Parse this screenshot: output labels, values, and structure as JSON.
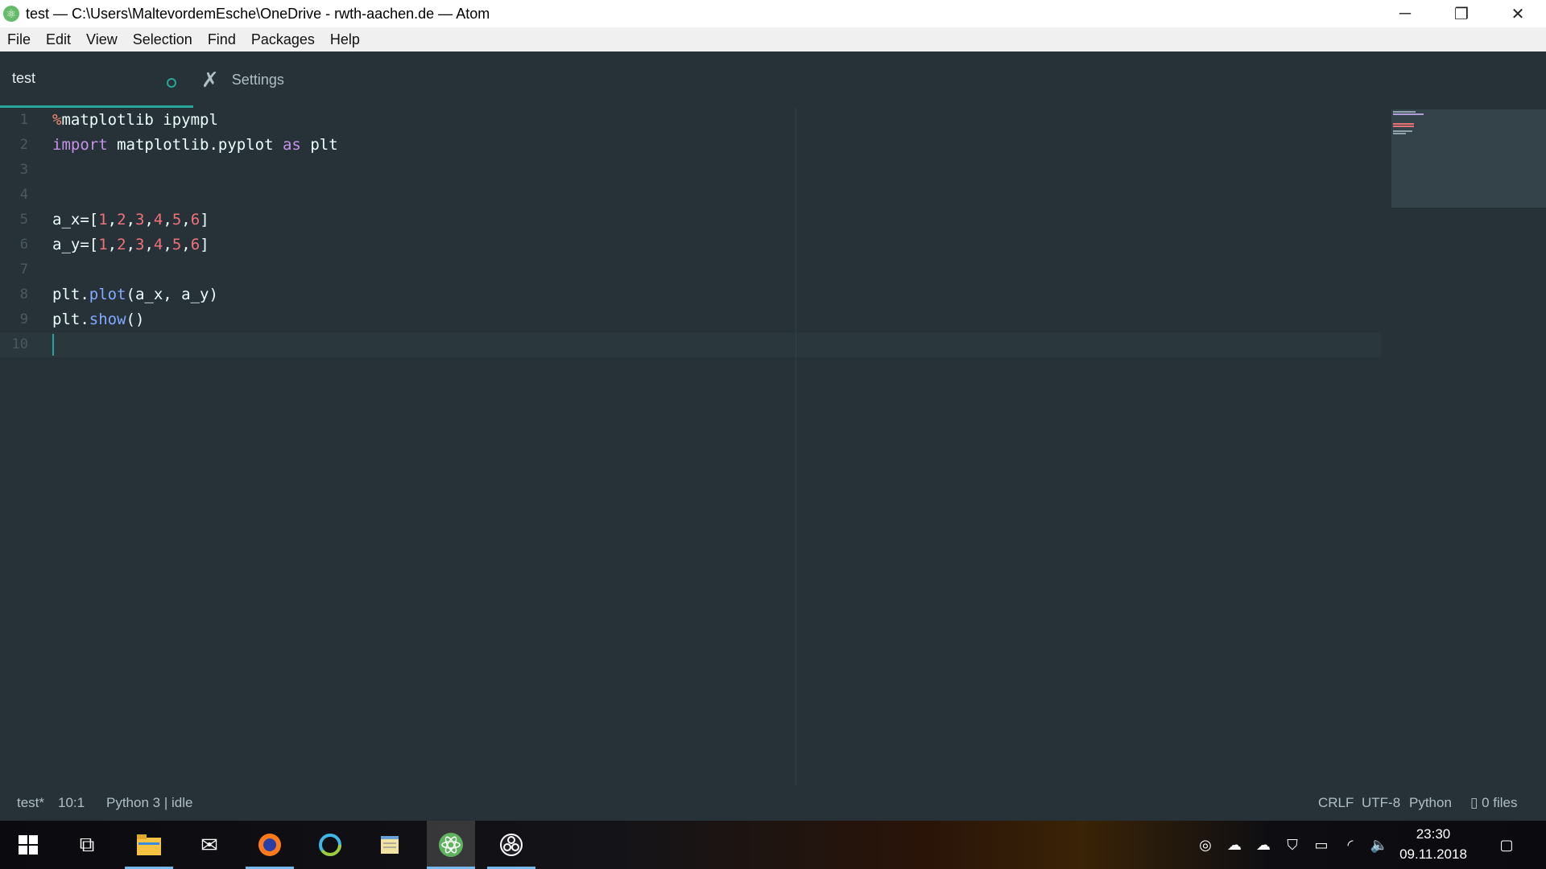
{
  "window": {
    "title": "test — C:\\Users\\MaltevordemEsche\\OneDrive - rwth-aachen.de — Atom",
    "controls": {
      "minimize": "─",
      "restore": "❐",
      "close": "✕"
    }
  },
  "menu": [
    "File",
    "Edit",
    "View",
    "Selection",
    "Find",
    "Packages",
    "Help"
  ],
  "tabs": [
    {
      "title": "test",
      "modified": true
    },
    {
      "title": "Settings"
    }
  ],
  "editor": {
    "line_numbers": [
      "1",
      "2",
      "3",
      "4",
      "5",
      "6",
      "7",
      "8",
      "9",
      "10"
    ],
    "lines": {
      "l1": {
        "magic": "%",
        "rest": "matplotlib ipympl"
      },
      "l2": {
        "kw_import": "import",
        "module": " matplotlib.pyplot ",
        "kw_as": "as",
        "alias": " plt"
      },
      "l5": {
        "name": "a_x=[",
        "n1": "1",
        "n2": "2",
        "n3": "3",
        "n4": "4",
        "n5": "5",
        "n6": "6",
        "close": "]"
      },
      "l6": {
        "name": "a_y=[",
        "n1": "1",
        "n2": "2",
        "n3": "3",
        "n4": "4",
        "n5": "5",
        "n6": "6",
        "close": "]"
      },
      "l8": {
        "obj": "plt.",
        "fn": "plot",
        "args": "(a_x, a_y)"
      },
      "l9": {
        "obj": "plt.",
        "fn": "show",
        "args": "()"
      }
    },
    "syntax_colors": {
      "magic": "#f78c6c",
      "keyword": "#c792ea",
      "number": "#f07178",
      "function": "#82aaff",
      "accent": "#26a69a"
    }
  },
  "status": {
    "file": "test*",
    "cursor": "10:1",
    "kernel": "Python 3 | idle",
    "line_ending": "CRLF",
    "encoding": "UTF-8",
    "grammar": "Python",
    "git": "0 files"
  },
  "taskbar": {
    "apps": [
      "windows-start",
      "task-view",
      "file-explorer",
      "mail",
      "firefox",
      "browser-circle",
      "notepad",
      "atom",
      "obs-studio"
    ],
    "time": "23:30",
    "date": "09.11.2018"
  }
}
